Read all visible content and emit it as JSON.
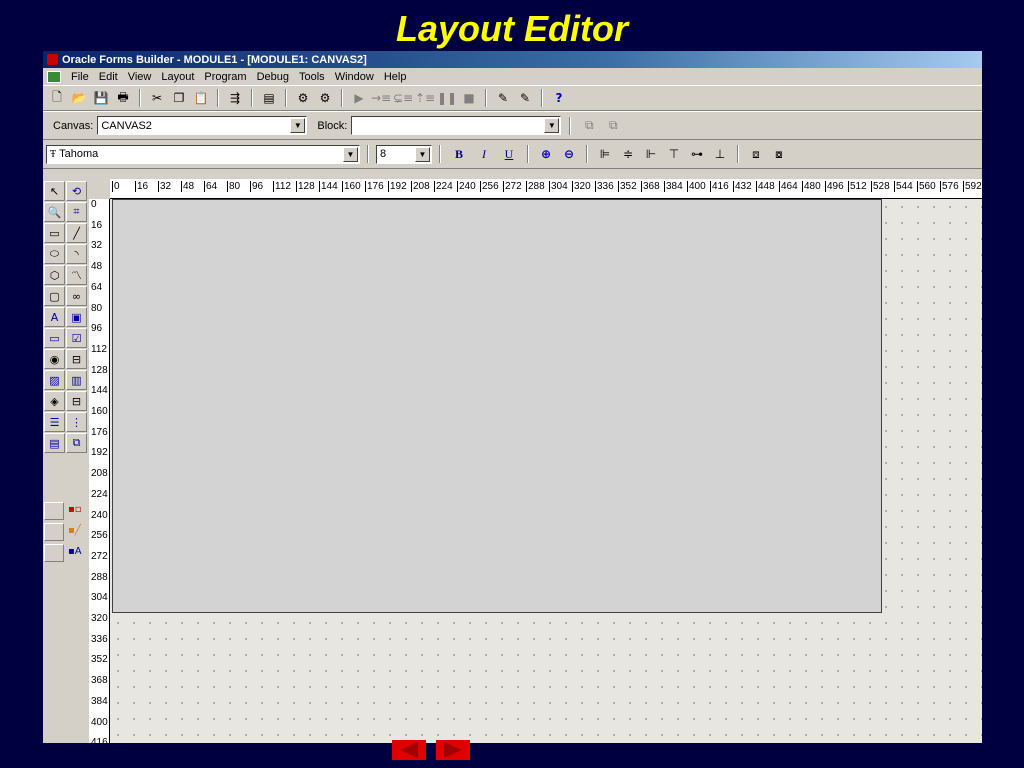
{
  "slide": {
    "title": "Layout Editor"
  },
  "window": {
    "title": "Oracle Forms Builder - MODULE1 - [MODULE1: CANVAS2]"
  },
  "menu": [
    "File",
    "Edit",
    "View",
    "Layout",
    "Program",
    "Debug",
    "Tools",
    "Window",
    "Help"
  ],
  "toolbar_icons": [
    "new-file-icon",
    "open-folder-icon",
    "save-icon",
    "print-icon",
    "cut-icon",
    "copy-icon",
    "paste-icon",
    "compile-icon",
    "run-form-icon",
    "debug-run-icon",
    "step-into-icon",
    "step-over-icon",
    "step-out-icon",
    "pause-icon",
    "stop-icon",
    "wizard-icon",
    "reentrant-wizard-icon",
    "help-icon"
  ],
  "canvasbar": {
    "canvas_label": "Canvas:",
    "canvas_value": "CANVAS2",
    "block_label": "Block:",
    "block_value": ""
  },
  "fontbar": {
    "font_name": "Tahoma",
    "font_size": "8",
    "bold": "B",
    "italic": "I",
    "underline": "U"
  },
  "ruler": {
    "h_ticks": [
      "0",
      "16",
      "32",
      "48",
      "64",
      "80",
      "96",
      "112",
      "128",
      "144",
      "160",
      "176",
      "192",
      "208",
      "224",
      "240",
      "256",
      "272",
      "288",
      "304",
      "320",
      "336",
      "352",
      "368",
      "384",
      "400",
      "416",
      "432",
      "448",
      "464",
      "480",
      "496",
      "512",
      "528",
      "544",
      "560",
      "576",
      "592"
    ],
    "v_ticks": [
      "0",
      "16",
      "32",
      "48",
      "64",
      "80",
      "96",
      "112",
      "128",
      "144",
      "160",
      "176",
      "192",
      "208",
      "224",
      "240",
      "256",
      "272",
      "288",
      "304",
      "320",
      "336",
      "352",
      "368",
      "384",
      "400",
      "416"
    ]
  },
  "colors": {
    "slide_bg": "#000040",
    "title": "#ffff00",
    "chrome": "#d4d0c8",
    "canvas": "#d3d3d3",
    "nav": "#e00000"
  }
}
